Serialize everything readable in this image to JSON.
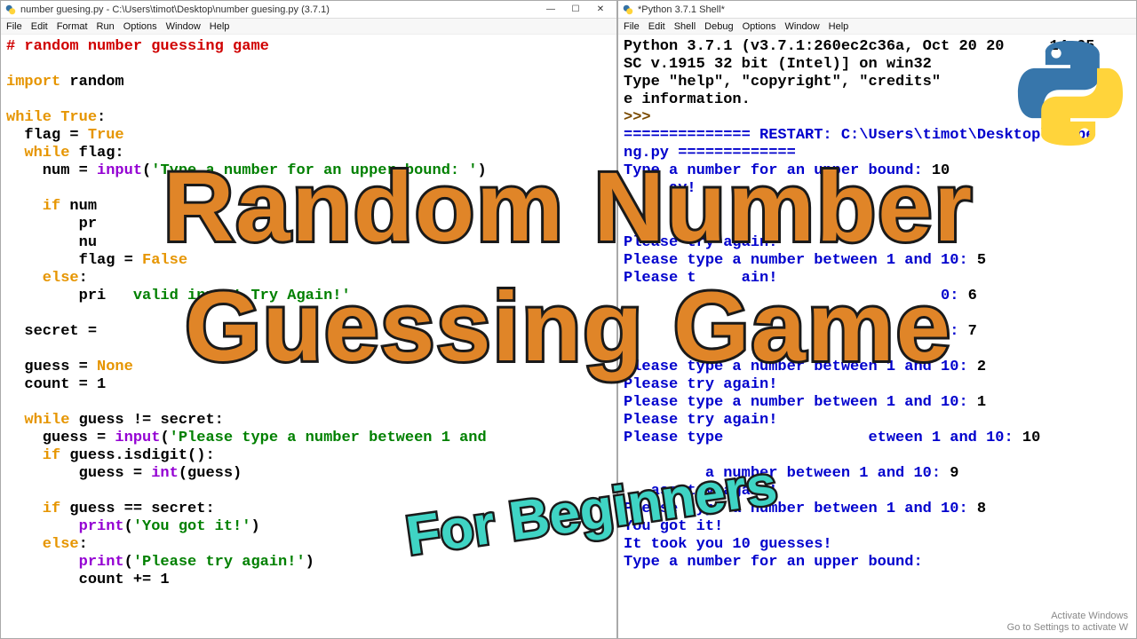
{
  "editor": {
    "title": "number guesing.py - C:\\Users\\timot\\Desktop\\number guesing.py (3.7.1)",
    "menu": [
      "File",
      "Edit",
      "Format",
      "Run",
      "Options",
      "Window",
      "Help"
    ],
    "window_controls": {
      "min": "—",
      "max": "☐",
      "close": "✕"
    },
    "code": {
      "l1_comment": "# random number guessing game",
      "l2_kw": "import",
      "l2_mod": " random",
      "l3_kw": "while ",
      "l3_val": "True",
      "l3_colon": ":",
      "l4_a": "  flag = ",
      "l4_b": "True",
      "l5_a": "  while",
      "l5_b": " flag:",
      "l6_a": "    num = ",
      "l6_b": "input",
      "l6_c": "(",
      "l6_d": "'Type a number for an upper bound: '",
      "l6_e": ")",
      "l7_a": "    if",
      "l7_b": " num",
      "l8_a": "        pr",
      "l9_a": "        nu",
      "l10_a": "        flag = ",
      "l10_b": "False",
      "l11_a": "    else",
      "l11_b": ":",
      "l12_a": "        pri",
      "l12_c": "valid input! Try Again!'",
      "l13_a": "  secret = ",
      "l14_a": "  guess = ",
      "l14_b": "None",
      "l15_a": "  count = 1",
      "l16_a": "  while",
      "l16_b": " guess != secret:",
      "l17_a": "    guess = ",
      "l17_b": "input",
      "l17_c": "(",
      "l17_d": "'Please type a number between 1 and",
      "l18_a": "    if",
      "l18_b": " guess.isdigit():",
      "l19_a": "        guess = ",
      "l19_b": "int",
      "l19_c": "(guess)",
      "l20_a": "    if",
      "l20_b": " guess == secret:",
      "l21_a": "        print",
      "l21_b": "(",
      "l21_c": "'You got it!'",
      "l21_d": ")",
      "l22_a": "    else",
      "l22_b": ":",
      "l23_a": "        print",
      "l23_b": "(",
      "l23_c": "'Please try again!'",
      "l23_d": ")",
      "l24_a": "        count += 1"
    }
  },
  "shell": {
    "title": "*Python 3.7.1 Shell*",
    "menu": [
      "File",
      "Edit",
      "Shell",
      "Debug",
      "Options",
      "Window",
      "Help"
    ],
    "header1": "Python 3.7.1 (v3.7.1:260ec2c36a, Oct 20 20     14:05",
    "header2": "SC v.1915 32 bit (Intel)] on win32",
    "header3": "Type \"help\", \"copyright\", \"credits\"",
    "header4": "e information.",
    "prompt": ">>> ",
    "restart": "============== RESTART: C:\\Users\\timot\\Desktop\\numbe",
    "restart2": "ng.py =============",
    "io": [
      {
        "t": "Type a number for an upper bound: ",
        "v": "10"
      },
      {
        "t": "     ay!"
      },
      {
        "t": " "
      },
      {
        "t": " "
      },
      {
        "t": "Please try again!"
      },
      {
        "t": "Please type a number between 1 and 10: ",
        "v": "5"
      },
      {
        "t": "Please t     ain!"
      },
      {
        "t": "                                   0: ",
        "v": "6"
      },
      {
        "t": " "
      },
      {
        "t": "                                   0: ",
        "v": "7"
      },
      {
        "t": " "
      },
      {
        "t": "Please type a number between 1 and 10: ",
        "v": "2"
      },
      {
        "t": "Please try again!"
      },
      {
        "t": "Please type a number between 1 and 10: ",
        "v": "1"
      },
      {
        "t": "Please try again!"
      },
      {
        "t": "Please type                etween 1 and 10: ",
        "v": "10"
      },
      {
        "t": " "
      },
      {
        "t": "         a number between 1 and 10: ",
        "v": "9"
      },
      {
        "t": "   ase try again!"
      },
      {
        "t": "Please type a number between 1 and 10: ",
        "v": "8"
      },
      {
        "t": "You got it!"
      },
      {
        "t": "It took you 10 guesses!"
      },
      {
        "t": "Type a number for an upper bound:"
      }
    ]
  },
  "overlay": {
    "line1": "Random Number",
    "line2": "Guessing Game",
    "sub": "For Beginners"
  },
  "watermark": {
    "l1": "Activate Windows",
    "l2": "Go to Settings to activate W"
  }
}
